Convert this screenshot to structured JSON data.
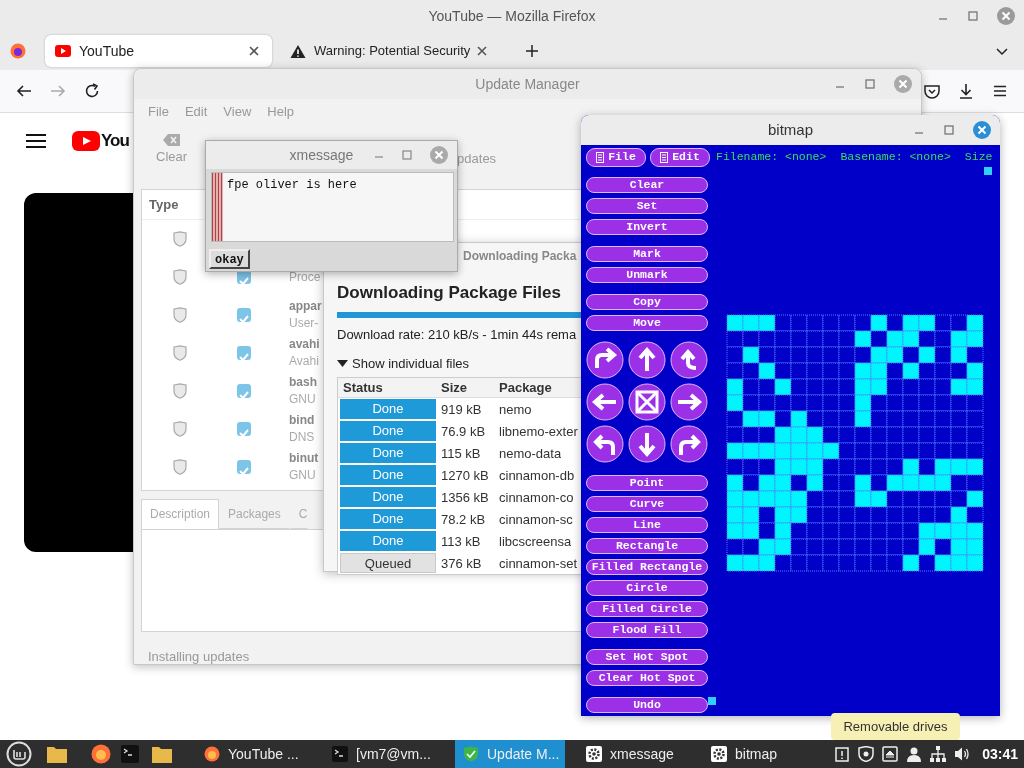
{
  "firefox": {
    "title": "YouTube — Mozilla Firefox",
    "tabs": [
      {
        "label": "YouTube",
        "selected": true
      },
      {
        "label": "Warning: Potential Security",
        "selected": false
      }
    ],
    "logo_text": "You"
  },
  "update_manager": {
    "title": "Update Manager",
    "menu": [
      "File",
      "Edit",
      "View",
      "Help"
    ],
    "toolbar": [
      "Clear",
      "pdates"
    ],
    "columns": [
      "Type"
    ],
    "rows": [
      {},
      {
        "description": "Proce",
        "checked": true
      },
      {
        "name": "appar",
        "description": "User-",
        "checked": true
      },
      {
        "name": "avahi",
        "description": "Avahi",
        "checked": true
      },
      {
        "name": "bash",
        "description": "GNU",
        "checked": true
      },
      {
        "name": "bind",
        "description": "DNS",
        "checked": true
      },
      {
        "name": "binut",
        "description": "GNU",
        "checked": true
      }
    ],
    "tabs": [
      {
        "label": "Description",
        "selected": true
      },
      {
        "label": "Packages",
        "selected": false
      },
      {
        "label": "C",
        "selected": false
      }
    ],
    "status_bar": "Installing updates"
  },
  "download": {
    "title": "Downloading Packa",
    "heading": "Downloading Package Files",
    "progress": {
      "level": 0.95
    },
    "rate": "Download rate: 210 kB/s - 1min 44s rema",
    "expander": {
      "label": "Show individual files",
      "expanded": true
    },
    "columns": [
      "Status",
      "Size",
      "Package"
    ],
    "rows": [
      {
        "status": "Done",
        "kind": "done",
        "size": "919 kB",
        "package": "nemo"
      },
      {
        "status": "Done",
        "kind": "done",
        "size": "76.9 kB",
        "package": "libnemo-exter"
      },
      {
        "status": "Done",
        "kind": "done",
        "size": "115 kB",
        "package": "nemo-data"
      },
      {
        "status": "Done",
        "kind": "done",
        "size": "1270 kB",
        "package": "cinnamon-db"
      },
      {
        "status": "Done",
        "kind": "done",
        "size": "1356 kB",
        "package": "cinnamon-co"
      },
      {
        "status": "Done",
        "kind": "done",
        "size": "78.2 kB",
        "package": "cinnamon-sc"
      },
      {
        "status": "Done",
        "kind": "done",
        "size": "113 kB",
        "package": "libcscreensa"
      },
      {
        "status": "Queued",
        "kind": "queued",
        "size": "376 kB",
        "package": "cinnamon-set"
      }
    ]
  },
  "xmessage": {
    "title": "xmessage",
    "message": "fpe oliver is here",
    "button": "okay"
  },
  "bitmap": {
    "title": "bitmap",
    "menus": [
      "File",
      "Edit"
    ],
    "info": [
      "Filename: <none>",
      "Basename: <none>",
      "Size"
    ],
    "tool_groups": [
      [
        "Clear",
        "Set",
        "Invert"
      ],
      [
        "Mark",
        "Unmark"
      ],
      [
        "Copy",
        "Move"
      ],
      [
        "Point",
        "Curve",
        "Line",
        "Rectangle",
        "Filled Rectangle",
        "Circle",
        "Filled Circle",
        "Flood Fill"
      ],
      [
        "Set Hot Spot",
        "Clear Hot Spot"
      ],
      [
        "Undo"
      ]
    ],
    "canvas": {
      "rows": [
        [
          true,
          true,
          true,
          false,
          false,
          false,
          false,
          false,
          false,
          true,
          false,
          true,
          true,
          false,
          false,
          true
        ],
        [
          false,
          false,
          false,
          false,
          false,
          false,
          false,
          false,
          true,
          false,
          true,
          true,
          false,
          false,
          true,
          true
        ],
        [
          false,
          true,
          false,
          false,
          false,
          false,
          false,
          false,
          false,
          true,
          true,
          false,
          true,
          false,
          true,
          false
        ],
        [
          false,
          false,
          true,
          false,
          false,
          false,
          false,
          false,
          true,
          true,
          false,
          true,
          false,
          false,
          false,
          true
        ],
        [
          true,
          false,
          false,
          true,
          false,
          false,
          false,
          false,
          true,
          true,
          false,
          false,
          false,
          false,
          true,
          true
        ],
        [
          true,
          false,
          false,
          false,
          false,
          false,
          false,
          false,
          true,
          false,
          false,
          false,
          false,
          false,
          false,
          false
        ],
        [
          false,
          true,
          true,
          false,
          true,
          false,
          false,
          false,
          true,
          false,
          false,
          false,
          false,
          false,
          false,
          false
        ],
        [
          false,
          false,
          false,
          true,
          true,
          true,
          false,
          false,
          false,
          false,
          false,
          false,
          false,
          false,
          false,
          false
        ],
        [
          true,
          true,
          true,
          true,
          true,
          true,
          true,
          false,
          false,
          false,
          false,
          false,
          false,
          false,
          false,
          false
        ],
        [
          false,
          false,
          false,
          true,
          true,
          true,
          false,
          false,
          false,
          false,
          false,
          true,
          false,
          true,
          true,
          true
        ],
        [
          true,
          false,
          true,
          true,
          false,
          true,
          false,
          false,
          true,
          false,
          true,
          true,
          true,
          true,
          false,
          false
        ],
        [
          true,
          true,
          true,
          true,
          true,
          false,
          false,
          false,
          true,
          true,
          false,
          false,
          false,
          false,
          false,
          true
        ],
        [
          true,
          true,
          false,
          true,
          true,
          false,
          false,
          false,
          false,
          false,
          false,
          false,
          false,
          false,
          true,
          false
        ],
        [
          true,
          true,
          false,
          true,
          false,
          false,
          false,
          false,
          false,
          false,
          false,
          false,
          true,
          true,
          true,
          true
        ],
        [
          false,
          false,
          true,
          true,
          false,
          false,
          false,
          false,
          false,
          false,
          false,
          false,
          true,
          false,
          true,
          true
        ],
        [
          true,
          true,
          true,
          false,
          false,
          false,
          false,
          false,
          false,
          false,
          false,
          true,
          false,
          true,
          true,
          true
        ]
      ]
    }
  },
  "taskbar": {
    "windows": [
      {
        "label": "YouTube ...",
        "kind": "browser",
        "selected": false
      },
      {
        "label": "[vm7@vm...",
        "kind": "terminal",
        "selected": false
      },
      {
        "label": "Update M...",
        "kind": "updater",
        "selected": true
      },
      {
        "label": "xmessage",
        "kind": "settings",
        "selected": false
      },
      {
        "label": "bitmap",
        "kind": "settings",
        "selected": false
      }
    ],
    "clock": "03:41"
  },
  "tooltip": "Removable drives"
}
